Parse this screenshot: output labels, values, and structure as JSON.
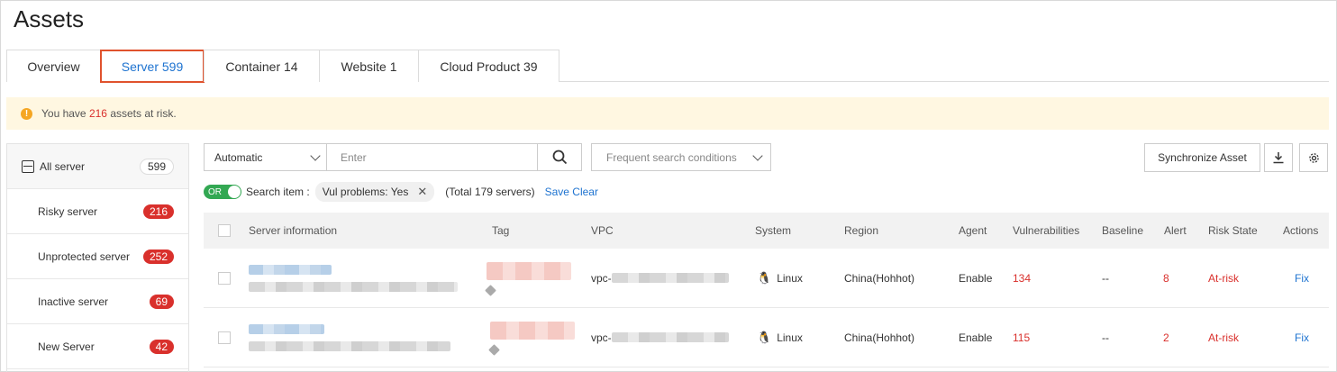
{
  "page_title": "Assets",
  "tabs": [
    {
      "label": "Overview"
    },
    {
      "label": "Server 599"
    },
    {
      "label": "Container 14"
    },
    {
      "label": "Website 1"
    },
    {
      "label": "Cloud Product 39"
    }
  ],
  "alert": {
    "prefix": "You have",
    "count": "216",
    "suffix": "assets at risk."
  },
  "sidebar": {
    "items": [
      {
        "label": "All server",
        "count": "599"
      },
      {
        "label": "Risky server",
        "count": "216"
      },
      {
        "label": "Unprotected server",
        "count": "252"
      },
      {
        "label": "Inactive server",
        "count": "69"
      },
      {
        "label": "New Server",
        "count": "42"
      }
    ]
  },
  "toolbar": {
    "mode": "Automatic",
    "search_placeholder": "Enter",
    "frequent_placeholder": "Frequent search conditions",
    "sync_label": "Synchronize Asset"
  },
  "filter": {
    "toggle": "OR",
    "search_item_label": "Search item :",
    "chip": "Vul problems: Yes",
    "total": "(Total 179 servers)",
    "save_clear": "Save Clear"
  },
  "table": {
    "headers": [
      "Server information",
      "Tag",
      "VPC",
      "System",
      "Region",
      "Agent",
      "Vulnerabilities",
      "Baseline",
      "Alert",
      "Risk State",
      "Actions"
    ],
    "rows": [
      {
        "vpc": "vpc-",
        "system": "Linux",
        "region": "China(Hohhot)",
        "agent": "Enable",
        "vulnerabilities": "134",
        "baseline": "--",
        "alert": "8",
        "risk_state": "At-risk",
        "action": "Fix"
      },
      {
        "vpc": "vpc-",
        "system": "Linux",
        "region": "China(Hohhot)",
        "agent": "Enable",
        "vulnerabilities": "115",
        "baseline": "--",
        "alert": "2",
        "risk_state": "At-risk",
        "action": "Fix"
      }
    ]
  },
  "colors": {
    "accent": "#1e73d0",
    "danger": "#d9302c",
    "active_tab_border": "#e0522d",
    "toggle_on": "#33a853",
    "alert_bg": "#fff7e1"
  }
}
